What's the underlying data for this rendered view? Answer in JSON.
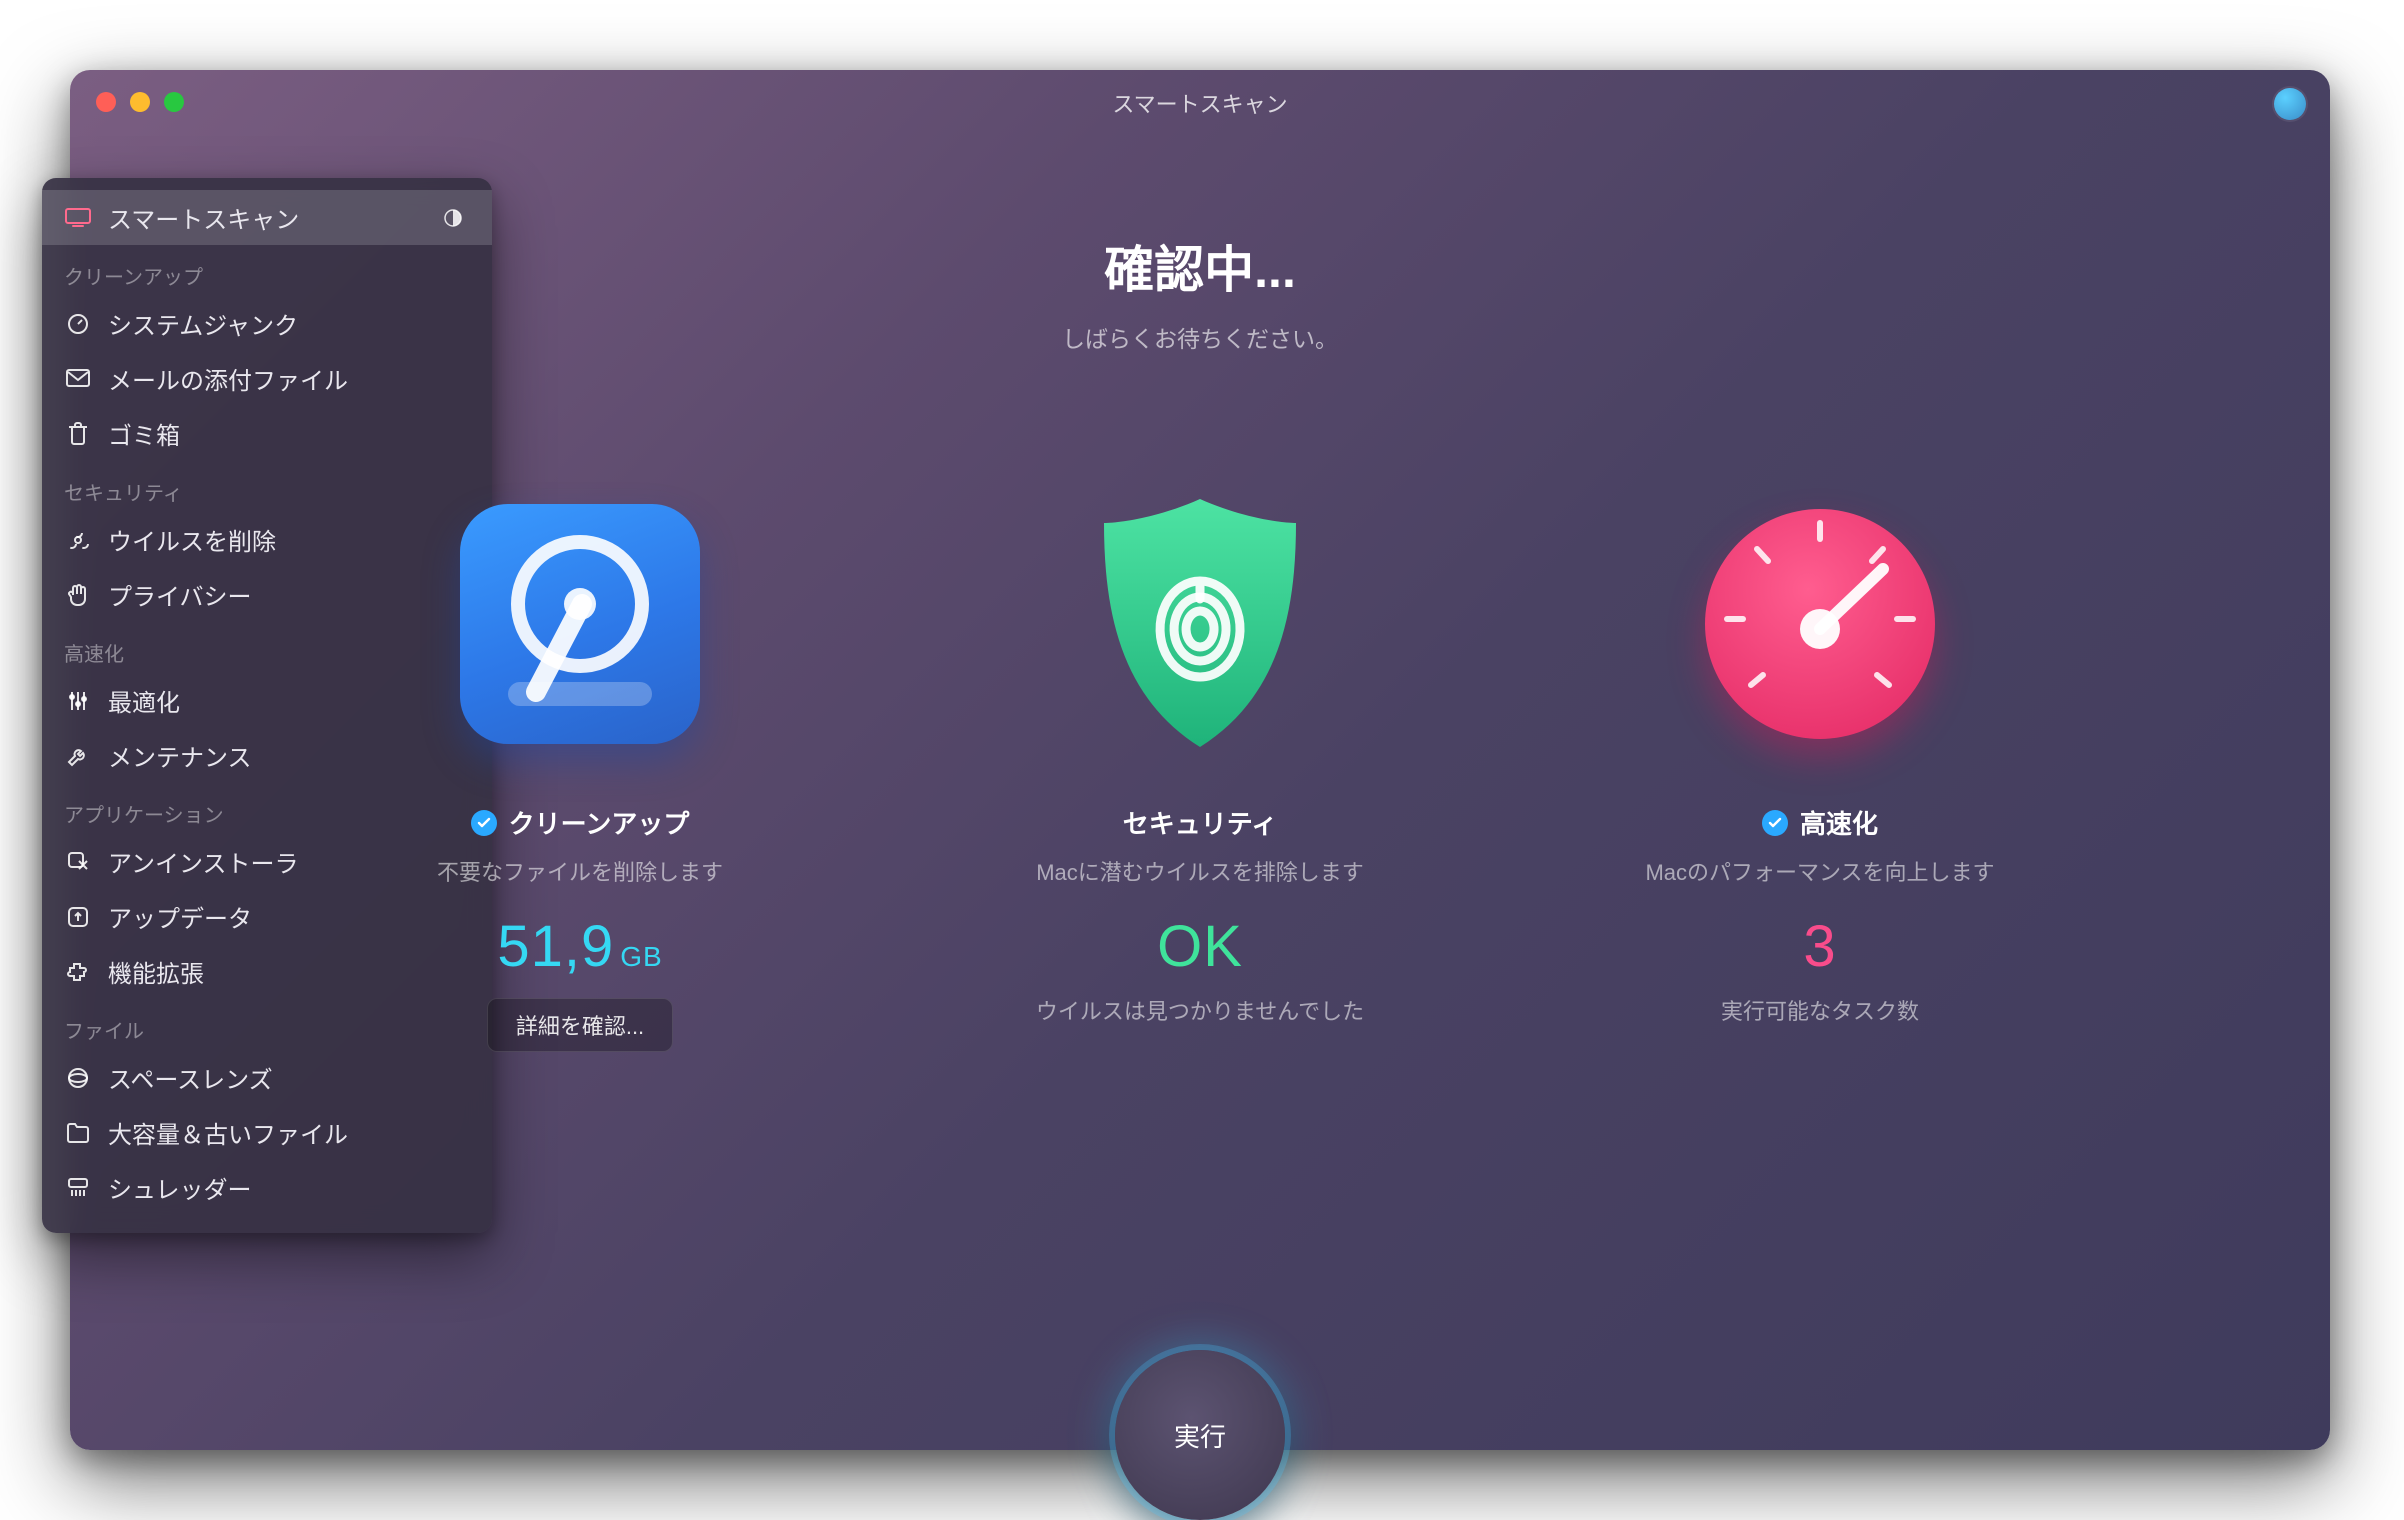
{
  "app": {
    "title": "スマートスキャン",
    "status_title": "確認中...",
    "status_subtitle": "しばらくお待ちください。",
    "run_button": "実行"
  },
  "sidebar": {
    "top": {
      "label": "スマートスキャン",
      "icon": "device-icon"
    },
    "sections": [
      {
        "header": "クリーンアップ",
        "items": [
          {
            "label": "システムジャンク",
            "icon": "gauge-icon"
          },
          {
            "label": "メールの添付ファイル",
            "icon": "mail-icon"
          },
          {
            "label": "ゴミ箱",
            "icon": "trash-icon"
          }
        ]
      },
      {
        "header": "セキュリティ",
        "items": [
          {
            "label": "ウイルスを削除",
            "icon": "biohazard-icon"
          },
          {
            "label": "プライバシー",
            "icon": "hand-icon"
          }
        ]
      },
      {
        "header": "高速化",
        "items": [
          {
            "label": "最適化",
            "icon": "sliders-icon"
          },
          {
            "label": "メンテナンス",
            "icon": "wrench-icon"
          }
        ]
      },
      {
        "header": "アプリケーション",
        "items": [
          {
            "label": "アンインストーラ",
            "icon": "uninstall-icon"
          },
          {
            "label": "アップデータ",
            "icon": "update-icon"
          },
          {
            "label": "機能拡張",
            "icon": "puzzle-icon"
          }
        ]
      },
      {
        "header": "ファイル",
        "items": [
          {
            "label": "スペースレンズ",
            "icon": "lens-icon"
          },
          {
            "label": "大容量＆古いファイル",
            "icon": "folder-icon"
          },
          {
            "label": "シュレッダー",
            "icon": "shredder-icon"
          }
        ]
      }
    ]
  },
  "cards": {
    "cleanup": {
      "title": "クリーンアップ",
      "desc": "不要なファイルを削除します",
      "value": "51,9",
      "unit": "GB",
      "details_button": "詳細を確認...",
      "checked": true
    },
    "security": {
      "title": "セキュリティ",
      "desc": "Macに潜むウイルスを排除します",
      "value": "OK",
      "sub": "ウイルスは見つかりませんでした",
      "checked": false
    },
    "speed": {
      "title": "高速化",
      "desc": "Macのパフォーマンスを向上します",
      "value": "3",
      "sub": "実行可能なタスク数",
      "checked": true
    }
  },
  "colors": {
    "accent_cyan": "#35d8f3",
    "accent_green": "#3fe39b",
    "accent_pink": "#f94c8b",
    "check_blue": "#2aa9ff"
  }
}
